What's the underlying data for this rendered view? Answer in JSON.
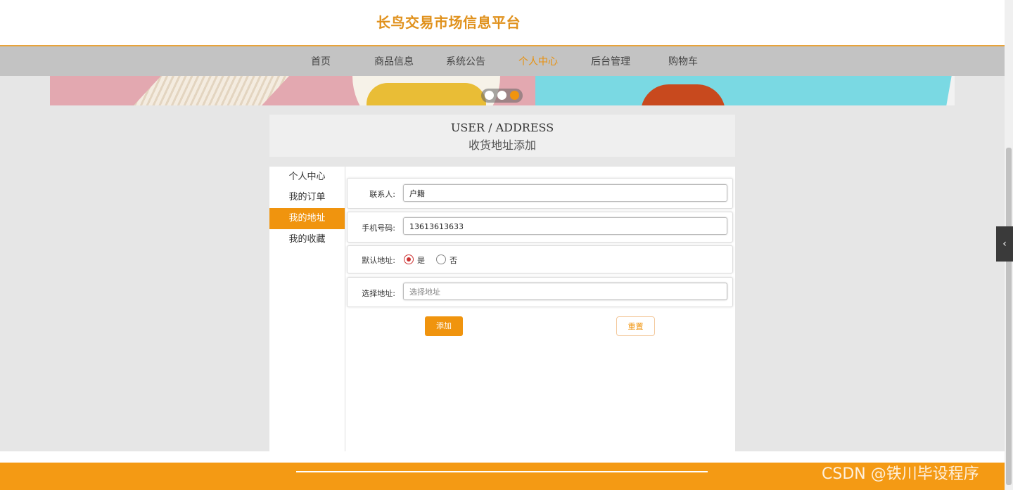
{
  "header": {
    "site_title": "长鸟交易市场信息平台"
  },
  "nav": {
    "items": [
      {
        "label": "首页"
      },
      {
        "label": "商品信息"
      },
      {
        "label": "系统公告"
      },
      {
        "label": "个人中心"
      },
      {
        "label": "后台管理"
      },
      {
        "label": "购物车"
      }
    ],
    "active_index": 3
  },
  "carousel": {
    "slide_count": 3,
    "active_index": 2
  },
  "page_heading": {
    "en": "USER / ADDRESS",
    "cn": "收货地址添加"
  },
  "sidebar": {
    "items": [
      {
        "label": "个人中心"
      },
      {
        "label": "我的订单"
      },
      {
        "label": "我的地址"
      },
      {
        "label": "我的收藏"
      }
    ],
    "active_index": 2
  },
  "form": {
    "contact": {
      "label": "联系人:",
      "value": "户籍"
    },
    "phone": {
      "label": "手机号码:",
      "value": "13613613633"
    },
    "default_address": {
      "label": "默认地址:",
      "options": [
        "是",
        "否"
      ],
      "selected": "是"
    },
    "address": {
      "label": "选择地址:",
      "placeholder": "选择地址"
    },
    "add_label": "添加",
    "reset_label": "重置"
  },
  "watermark": "CSDN @铁川毕设程序",
  "colors": {
    "accent": "#f0940e",
    "title": "#e0911c",
    "nav_bg": "#c3c3c3"
  },
  "icons": {
    "side_toggle": "chevron-left-icon"
  }
}
